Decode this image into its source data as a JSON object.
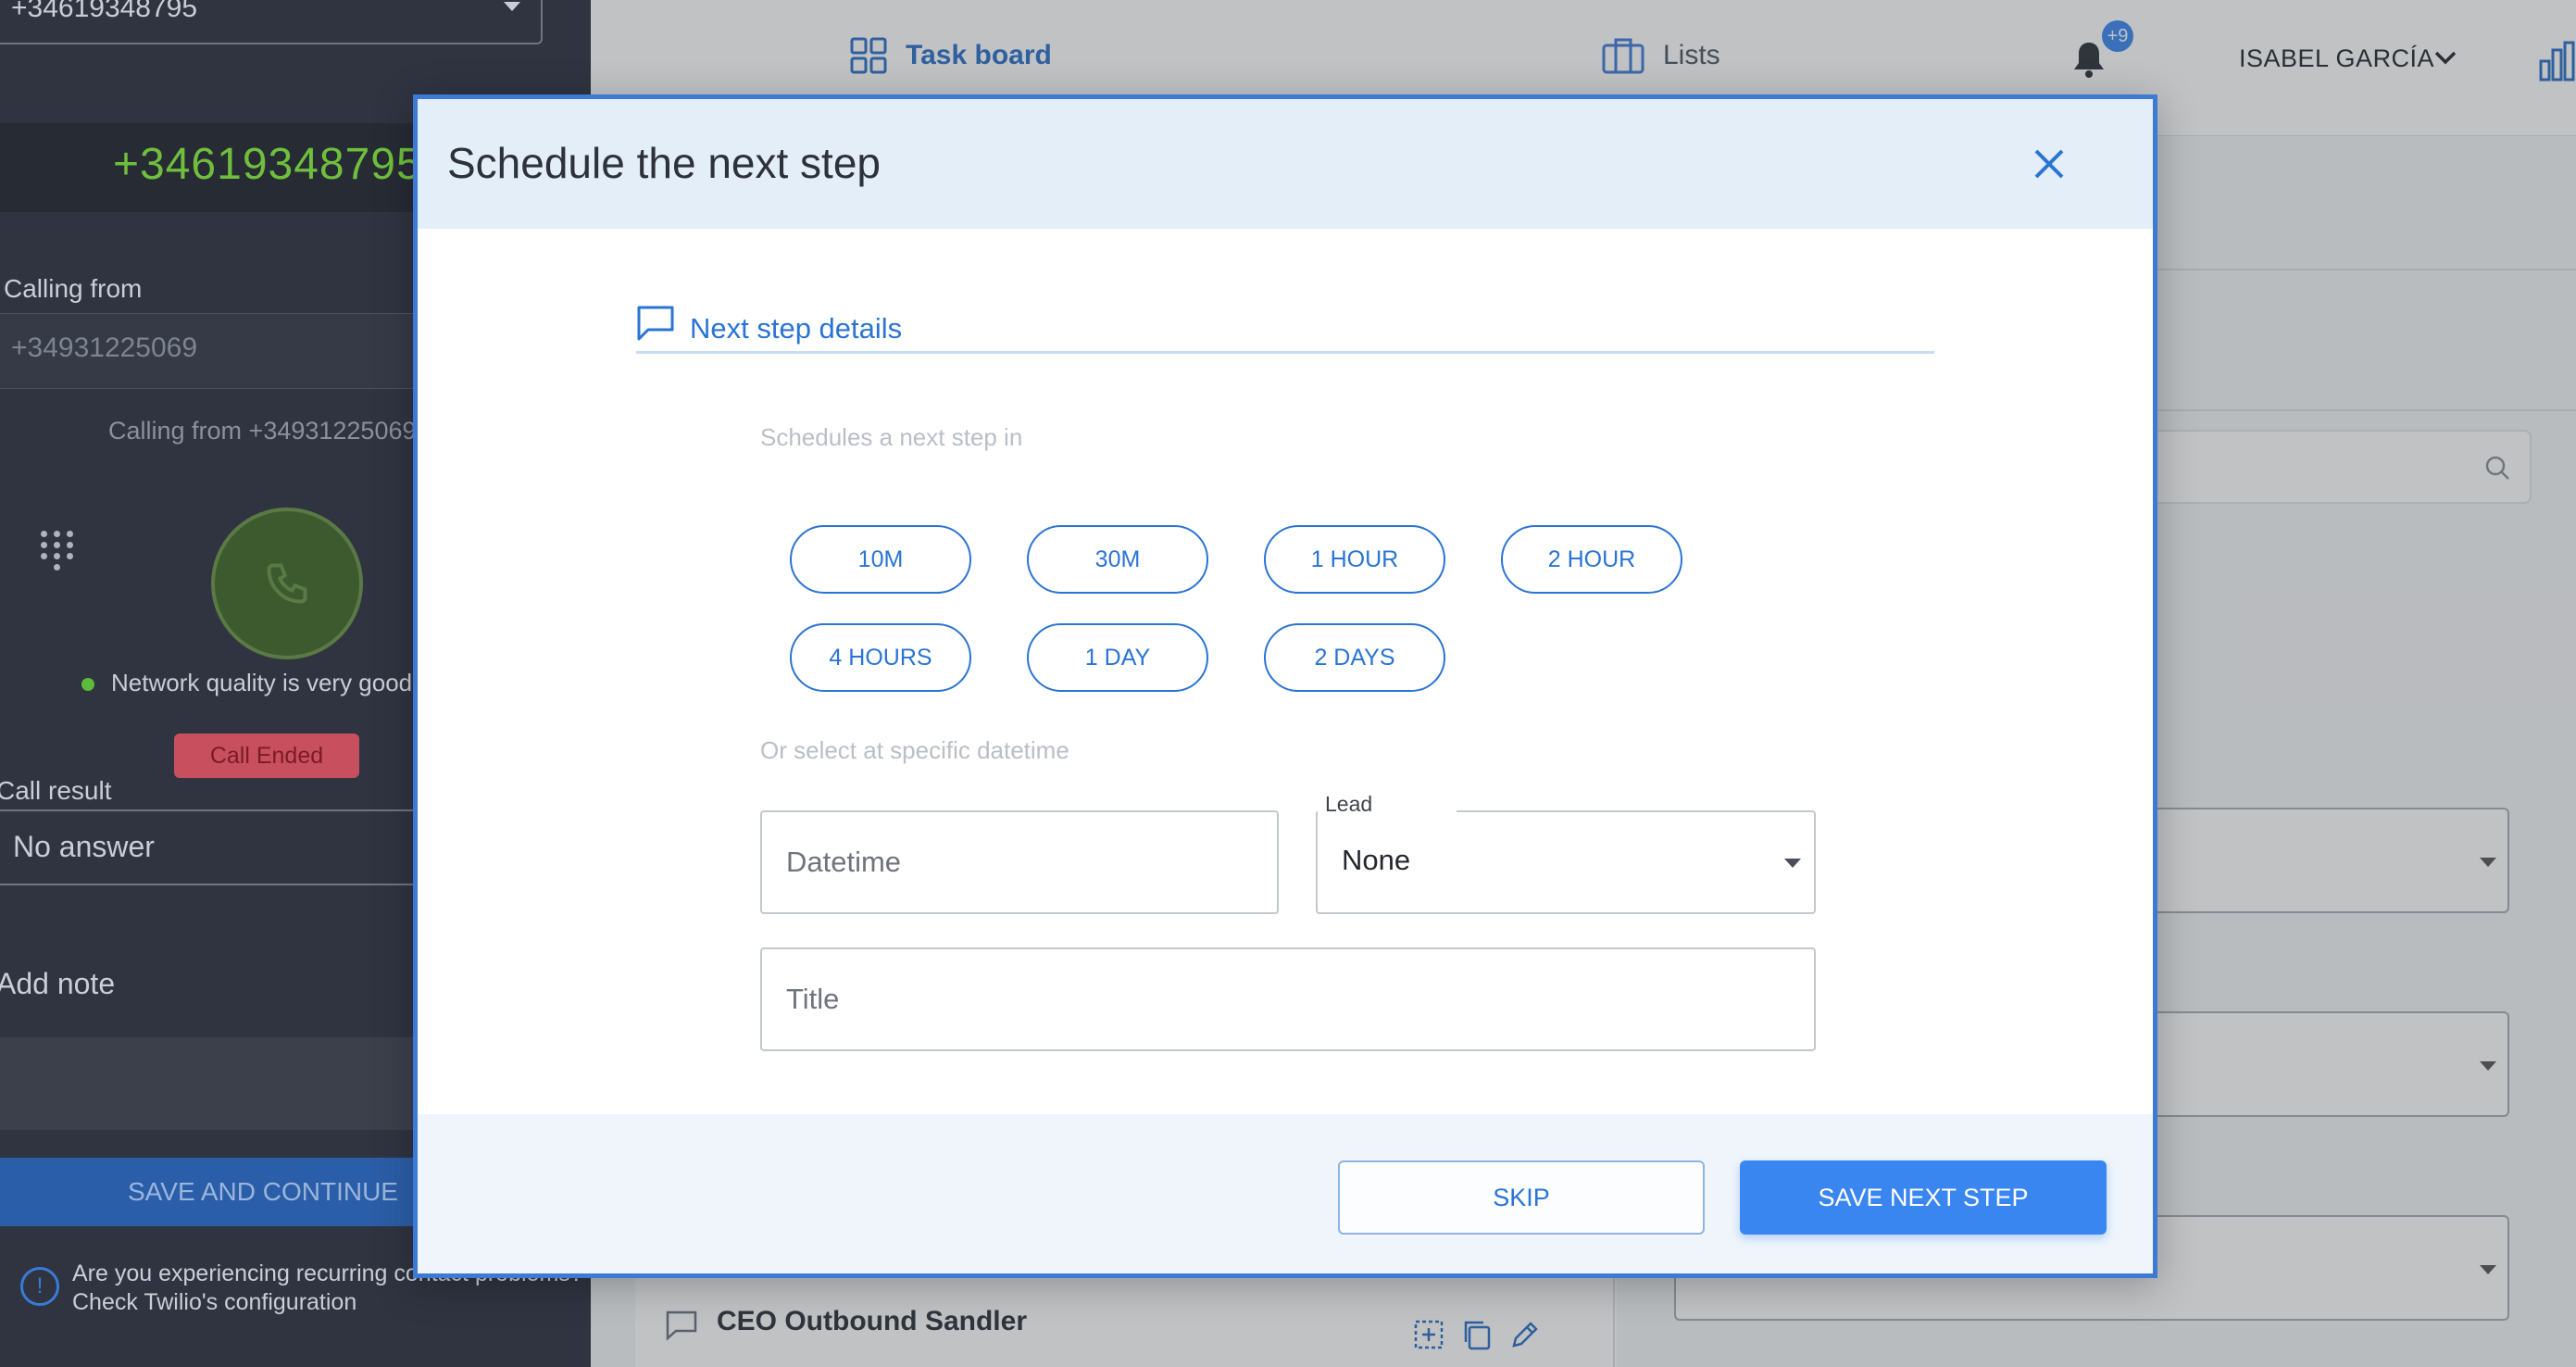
{
  "left_panel": {
    "top_select_value": "+34619348795",
    "dialed_number": "+34619348795",
    "calling_from_label": "Calling from",
    "calling_from_value": "+34931225069",
    "calling_from_sub": "Calling from +34931225069",
    "network_quality": "Network quality is very good",
    "call_status_badge": "Call Ended",
    "call_result_label": "Call result",
    "call_result_value": "No answer",
    "add_note_label": "Add note",
    "save_continue_label": "SAVE AND CONTINUE",
    "info_text": "Are you experiencing recurring contact problems? Check Twilio's configuration"
  },
  "topbar": {
    "nav": [
      {
        "label": "Task board",
        "icon": "grid-icon",
        "active": true
      },
      {
        "label": "Lists",
        "icon": "briefcase-icon",
        "active": false
      }
    ],
    "notification_badge": "+9",
    "user_name": "ISABEL GARCÍA"
  },
  "background_card": {
    "title": "CEO Outbound Sandler"
  },
  "modal": {
    "title": "Schedule the next step",
    "section_title": "Next step details",
    "schedule_label": "Schedules a next step in",
    "quick_options": [
      "10M",
      "30M",
      "1 HOUR",
      "2 HOUR",
      "4 HOURS",
      "1 DAY",
      "2 DAYS"
    ],
    "specific_label": "Or select at specific datetime",
    "datetime_placeholder": "Datetime",
    "lead_label": "Lead",
    "lead_value": "None",
    "title_placeholder": "Title",
    "skip_label": "SKIP",
    "save_label": "SAVE NEXT STEP"
  },
  "colors": {
    "accent": "#2a74d4",
    "primary_button": "#3a86f0",
    "modal_header_bg": "#e3eef8",
    "dark_panel": "#2f3440",
    "number_green": "#6fbf3d",
    "badge_red": "#c8505e"
  }
}
